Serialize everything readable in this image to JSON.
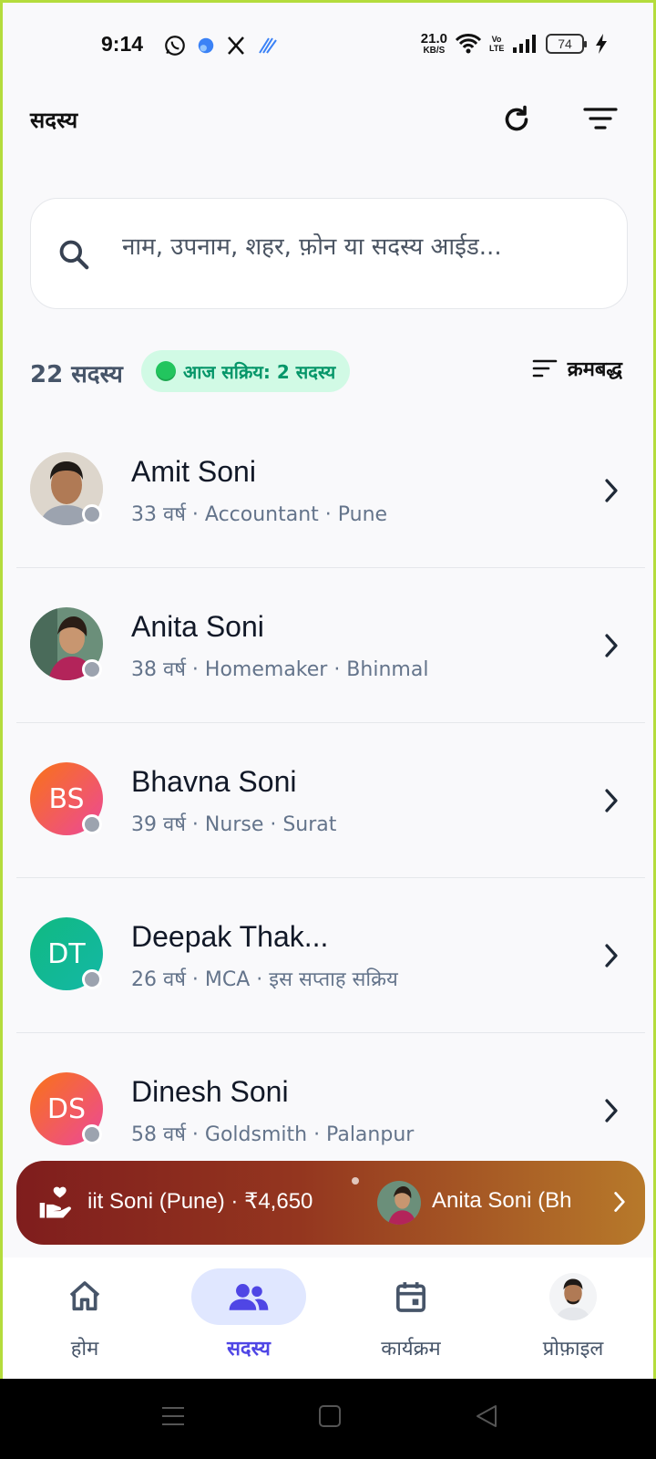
{
  "status_bar": {
    "time": "9:14",
    "net_speed_value": "21.0",
    "net_speed_unit": "KB/S",
    "volte": "Vo LTE",
    "battery": "74",
    "icons": [
      "whatsapp-icon",
      "app-icon",
      "x-icon",
      "app-icon",
      "wifi-icon",
      "signal-icon",
      "battery-icon",
      "charging-icon"
    ]
  },
  "header": {
    "title": "सदस्य",
    "icons": [
      "refresh-icon",
      "filter-icon"
    ]
  },
  "search": {
    "placeholder": "नाम, उपनाम, शहर, फ़ोन या सदस्य आईड..."
  },
  "summary": {
    "count": "22 सदस्य",
    "active_today": "आज सक्रिय: 2 सदस्य",
    "sort_label": "क्रमबद्ध"
  },
  "members": [
    {
      "name": "Amit Soni",
      "meta": "33 वर्ष · Accountant · Pune",
      "initials": "",
      "avatar_type": "photo"
    },
    {
      "name": "Anita Soni",
      "meta": "38 वर्ष · Homemaker · Bhinmal",
      "initials": "",
      "avatar_type": "photo"
    },
    {
      "name": "Bhavna Soni",
      "meta": "39 वर्ष · Nurse · Surat",
      "initials": "BS",
      "avatar_type": "initials"
    },
    {
      "name": "Deepak Thak...",
      "meta": "26 वर्ष · MCA · इस सप्ताह सक्रिय",
      "initials": "DT",
      "avatar_type": "initials"
    },
    {
      "name": "Dinesh Soni",
      "meta": "58 वर्ष · Goldsmith · Palanpur",
      "initials": "DS",
      "avatar_type": "initials"
    }
  ],
  "ticker": {
    "item1": "iit Soni (Pune) · ₹4,650",
    "item2": "Anita Soni (Bh"
  },
  "bottom_nav": {
    "items": [
      {
        "label": "होम",
        "icon": "home-icon"
      },
      {
        "label": "सदस्य",
        "icon": "members-icon"
      },
      {
        "label": "कार्यक्रम",
        "icon": "calendar-icon"
      },
      {
        "label": "प्रोफ़ाइल",
        "icon": "profile-avatar"
      }
    ],
    "active": "सदस्य"
  },
  "colors": {
    "accent": "#4f46e5",
    "active_pill_bg": "#d1fae5",
    "active_pill_text": "#059669",
    "ticker_start": "#7f1d1d",
    "ticker_end": "#b7792a"
  }
}
